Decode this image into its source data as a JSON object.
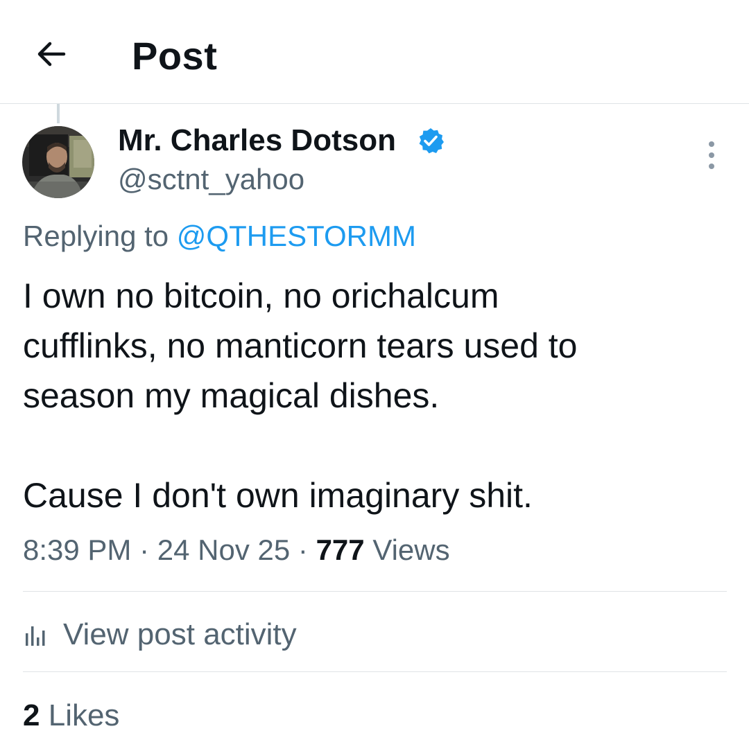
{
  "header": {
    "title": "Post",
    "back_icon": "arrow-left-icon"
  },
  "author": {
    "display_name": "Mr. Charles Dotson",
    "handle": "@sctnt_yahoo",
    "verified_icon": "verified-badge-icon",
    "verified_color": "#1d9bf0"
  },
  "reply": {
    "prefix": "Replying to",
    "mention": "@QTHESTORMM"
  },
  "post": {
    "text": "I own no bitcoin, no orichalcum\ncufflinks, no manticorn tears used to\nseason my magical dishes.\n\nCause I don't own imaginary shit."
  },
  "meta": {
    "time": "8:39 PM",
    "separator": "·",
    "date": "24 Nov 25",
    "views_count": "777",
    "views_label": "Views"
  },
  "activity": {
    "label": "View post activity",
    "icon": "bar-chart-icon"
  },
  "likes": {
    "count": "2",
    "label": "Likes"
  },
  "colors": {
    "accent": "#1d9bf0",
    "secondary_text": "#536471",
    "primary_text": "#0f1419",
    "divider": "#dfe3e6"
  }
}
